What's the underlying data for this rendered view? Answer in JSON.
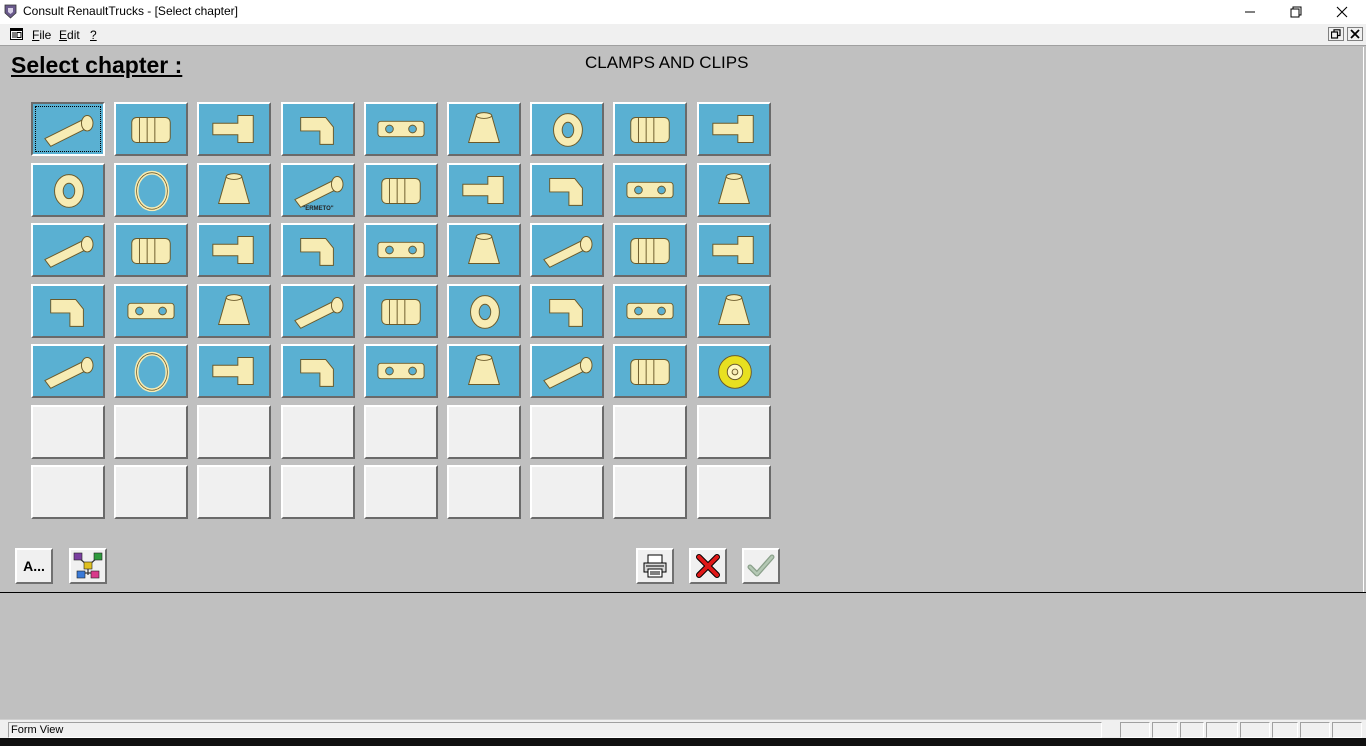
{
  "window": {
    "title": "Consult RenaultTrucks - [Select chapter]",
    "minimize_icon": "minimize-icon",
    "restore_icon": "restore-icon",
    "close_icon": "close-icon"
  },
  "menu": {
    "items": [
      {
        "label": "File",
        "accel": "F",
        "rest": "ile"
      },
      {
        "label": "Edit",
        "accel": "E",
        "rest": "dit"
      },
      {
        "label": "?",
        "accel": "?",
        "rest": ""
      }
    ]
  },
  "header": {
    "title": "Select chapter :",
    "chapter": "CLAMPS AND CLIPS"
  },
  "tiles": [
    {
      "icon": "bolt-icon"
    },
    {
      "icon": "threaded-plug-icon"
    },
    {
      "icon": "threaded-rod-icon"
    },
    {
      "icon": "screw-icon"
    },
    {
      "icon": "stud-bolt-icon"
    },
    {
      "icon": "shouldered-bolt-icon"
    },
    {
      "icon": "hex-nut-icon"
    },
    {
      "icon": "square-nut-icon"
    },
    {
      "icon": "cage-nut-icon"
    },
    {
      "icon": "washer-icon"
    },
    {
      "icon": "hose-clamp-icon"
    },
    {
      "icon": "hose-elbow-icon"
    },
    {
      "icon": "ermeto-elbow-icon",
      "tag": "\"ERMETO\""
    },
    {
      "icon": "elbow-union-icon"
    },
    {
      "icon": "angle-union-icon"
    },
    {
      "icon": "straight-union-icon"
    },
    {
      "icon": "tee-union-icon"
    },
    {
      "icon": "banjo-union-icon"
    },
    {
      "icon": "quick-coupling-icon"
    },
    {
      "icon": "push-in-elbow-icon"
    },
    {
      "icon": "union-kit-icon"
    },
    {
      "icon": "seal-rings-icon"
    },
    {
      "icon": "chain-icon"
    },
    {
      "icon": "belt-link-icon"
    },
    {
      "icon": "needle-bearing-icon"
    },
    {
      "icon": "ball-bearing-icon"
    },
    {
      "icon": "roller-bearing-icon"
    },
    {
      "icon": "threaded-adapter-icon"
    },
    {
      "icon": "connector-block-icon"
    },
    {
      "icon": "relay-icon"
    },
    {
      "icon": "cable-terminal-icon"
    },
    {
      "icon": "bellows-icon"
    },
    {
      "icon": "grommet-icon"
    },
    {
      "icon": "spring-icon"
    },
    {
      "icon": "bulb-icon"
    },
    {
      "icon": "fuse-icon"
    },
    {
      "icon": "pin-icon"
    },
    {
      "icon": "circlip-icon"
    },
    {
      "icon": "key-icon"
    },
    {
      "icon": "tool-rod-icon"
    },
    {
      "icon": "split-pins-icon"
    },
    {
      "icon": "bushing-icon"
    },
    {
      "icon": "rivet-icon"
    },
    {
      "icon": "dowel-icon"
    },
    {
      "icon": "tape-roll-icon"
    },
    {},
    {},
    {},
    {},
    {},
    {},
    {},
    {},
    {},
    {},
    {},
    {},
    {},
    {},
    {},
    {},
    {},
    {}
  ],
  "toolbar": {
    "alpha_label": "A...",
    "tree_icon": "tree-navigation-icon",
    "print_icon": "printer-icon",
    "cancel_icon": "cancel-x-icon",
    "ok_icon": "checkmark-icon"
  },
  "status": {
    "text": "Form View"
  },
  "colors": {
    "tile_fill": "#5ab0d2",
    "part_fill": "#f7ecb4",
    "window_bg": "#c0c0c0"
  }
}
